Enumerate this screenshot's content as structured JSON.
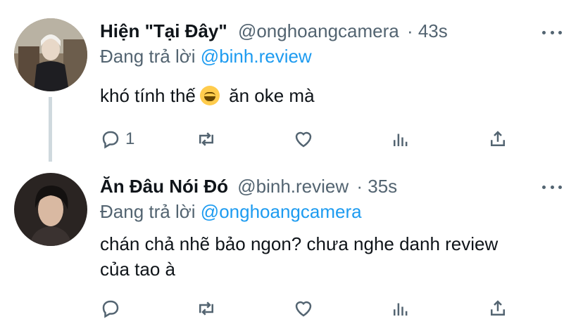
{
  "tweets": [
    {
      "display_name": "Hiện \"Tại Đây\"",
      "handle": "@onghoangcamera",
      "time": "· 43s",
      "replying_prefix": "Đang trả lời",
      "replying_to": "@binh.review",
      "text_before_emoji": "khó tính thế",
      "emoji": "grinning-sweat-emoji",
      "text_after_emoji": "ăn oke mà",
      "reply_count": "1",
      "avatar": "avatar-photo"
    },
    {
      "display_name": "Ăn Đâu Nói Đó",
      "handle": "@binh.review",
      "time": "· 35s",
      "replying_prefix": "Đang trả lời",
      "replying_to": "@onghoangcamera",
      "text_line1": "chán chả nhẽ bảo ngon? chưa nghe danh review",
      "text_line2": "của tao à",
      "reply_count": "",
      "avatar": "avatar-photo"
    }
  ],
  "icons": [
    "reply-icon",
    "retweet-icon",
    "like-icon",
    "analytics-icon",
    "share-icon",
    "more-icon"
  ],
  "colors": {
    "link": "#1d9bf0",
    "secondary": "#536471",
    "thread_line": "#cfd9de"
  }
}
